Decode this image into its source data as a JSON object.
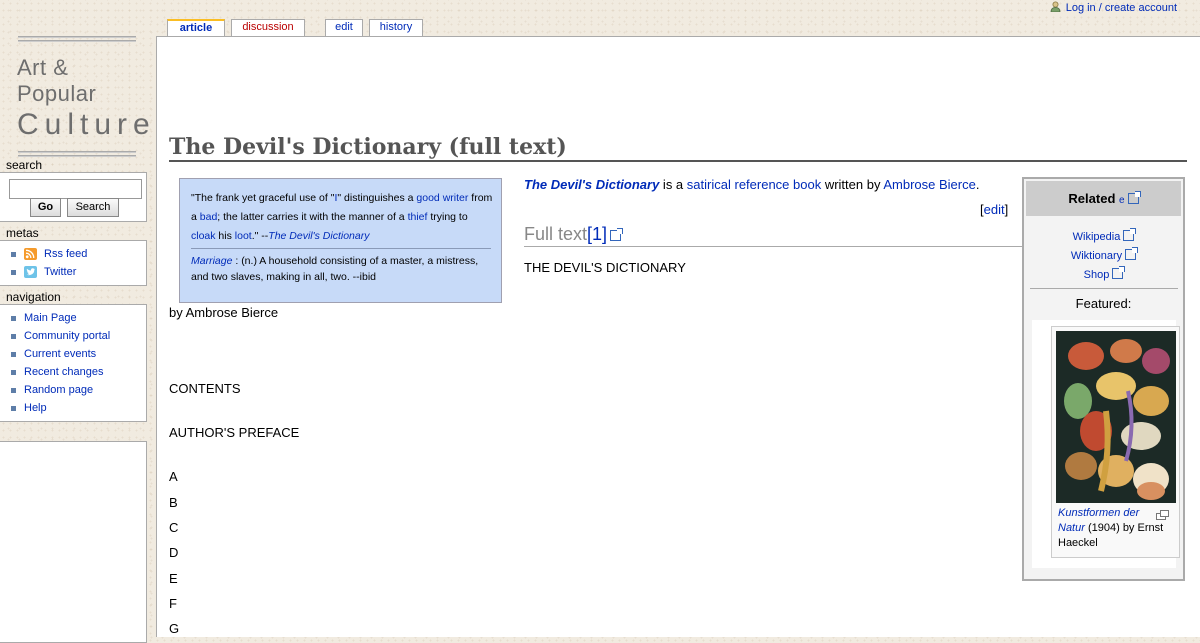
{
  "personal": {
    "login_label": "Log in / create account"
  },
  "logo": {
    "line1": "Art & Popular",
    "line2": "Culture"
  },
  "tabs": [
    {
      "label": "article",
      "state": "selected"
    },
    {
      "label": "discussion",
      "state": "new"
    },
    {
      "label": "edit",
      "state": "normal"
    },
    {
      "label": "history",
      "state": "normal"
    }
  ],
  "sidebar": {
    "search": {
      "heading": "search",
      "input_value": "",
      "go_label": "Go",
      "search_label": "Search"
    },
    "metas": {
      "heading": "metas",
      "items": [
        "Rss feed",
        "Twitter"
      ]
    },
    "navigation": {
      "heading": "navigation",
      "items": [
        "Main Page",
        "Community portal",
        "Current events",
        "Recent changes",
        "Random page",
        "Help"
      ]
    }
  },
  "page": {
    "title": "The Devil's Dictionary (full text)",
    "quote": {
      "p1": "\"The frank yet graceful use of \"",
      "p1_i": "I",
      "p1b": "\" distinguishes a ",
      "good": "good",
      "writer": "writer",
      "p1c": " from a ",
      "bad": "bad",
      "p1d": "; the latter carries it with the manner of a ",
      "thief": "thief",
      "p1e": " trying to ",
      "cloak": "cloak",
      "p1f": " his ",
      "loot": "loot",
      "p1g": ".\" --",
      "source": "The Devil's Dictionary",
      "marriage_term": "Marriage",
      "marriage_def": " : (n.) A household consisting of a master, a mistress, and two slaves, making in all, two. --ibid"
    },
    "intro": {
      "book": "The Devil's Dictionary",
      "is_a": " is a ",
      "satirical": "satirical",
      "reference_book": "reference book",
      "written_by": " written by ",
      "author": "Ambrose Bierce",
      "period": "."
    },
    "edit_label": "edit",
    "section_heading": "Full text",
    "section_ref": "[1]",
    "body": {
      "heading": "THE DEVIL'S DICTIONARY",
      "byline": "by Ambrose Bierce",
      "contents": "CONTENTS",
      "preface": "AUTHOR'S PREFACE",
      "letters": [
        "A",
        "B",
        "C",
        "D",
        "E",
        "F",
        "G"
      ]
    }
  },
  "related": {
    "heading": "Related",
    "heading_suffix": "e",
    "links": [
      "Wikipedia",
      "Wiktionary",
      "Shop"
    ],
    "featured_label": "Featured:",
    "caption_title": "Kunstformen der Natur",
    "caption_rest": " (1904) by Ernst Haeckel"
  }
}
